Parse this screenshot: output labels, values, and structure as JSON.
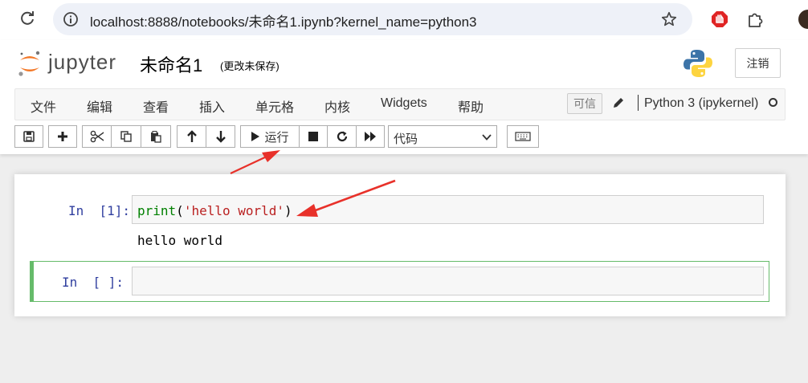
{
  "browser": {
    "url": "localhost:8888/notebooks/未命名1.ipynb?kernel_name=python3"
  },
  "header": {
    "logo_text": "jupyter",
    "notebook_name": "未命名1",
    "save_status": "(更改未保存)",
    "logout_label": "注销"
  },
  "menubar": {
    "items": [
      "文件",
      "编辑",
      "查看",
      "插入",
      "单元格",
      "内核",
      "Widgets",
      "帮助"
    ],
    "trusted_label": "可信",
    "kernel_name": "Python 3 (ipykernel)"
  },
  "toolbar": {
    "run_label": "运行",
    "cell_type": "代码"
  },
  "cells": [
    {
      "prompt": "In  [1]:",
      "code_func": "print",
      "code_open": "(",
      "code_string": "'hello world'",
      "code_close": ")",
      "output": "hello world"
    },
    {
      "prompt": "In  [ ]:",
      "code": ""
    }
  ],
  "colors": {
    "prompt": "#303f9f",
    "code_builtin": "#008000",
    "code_string": "#ba2121",
    "selected_cell": "#66bb6a",
    "annotation_arrow": "#e8312a"
  }
}
